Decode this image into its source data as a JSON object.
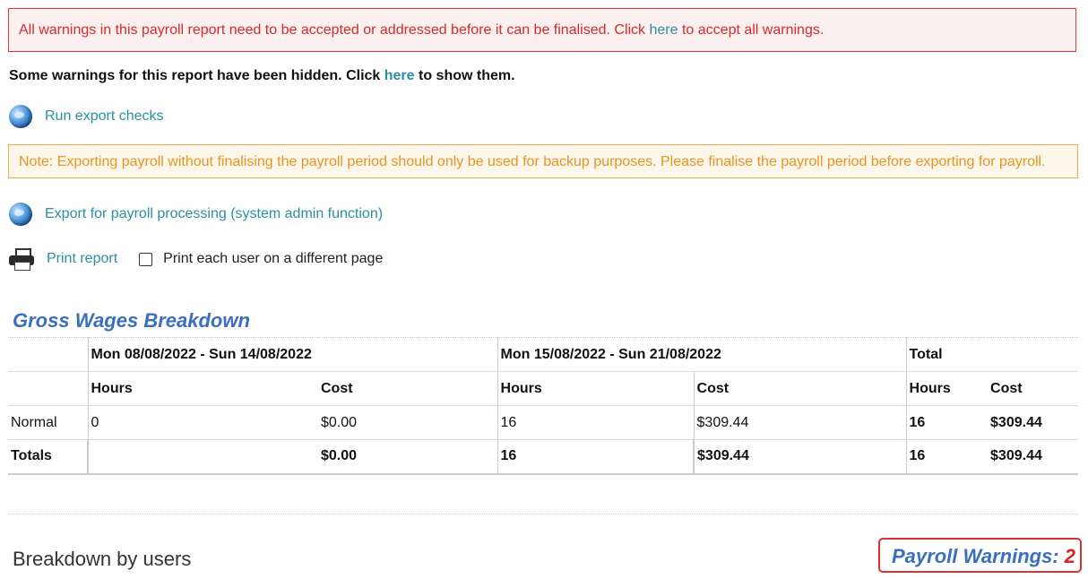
{
  "alert_red": {
    "text_before": "All warnings in this payroll report need to be accepted or addressed before it can be finalised. Click ",
    "link": "here",
    "text_after": " to accept all warnings."
  },
  "hidden_note": {
    "text_before": "Some warnings for this report have been hidden. Click ",
    "link": "here",
    "text_after": " to show them."
  },
  "actions": {
    "run_checks": "Run export checks",
    "export": "Export for payroll processing (system admin function)",
    "print": "Print report",
    "print_each_label": "Print each user on a different page"
  },
  "alert_orange": "Note: Exporting payroll without finalising the payroll period should only be used for backup purposes. Please finalise the payroll period before exporting for payroll.",
  "gross_wages": {
    "title": "Gross Wages Breakdown",
    "periods": [
      "Mon 08/08/2022 - Sun 14/08/2022",
      "Mon 15/08/2022 - Sun 21/08/2022",
      "Total"
    ],
    "sub_headers": [
      "Hours",
      "Cost"
    ],
    "rows": [
      {
        "label": "Normal",
        "values": [
          "0",
          "$0.00",
          "16",
          "$309.44",
          "16",
          "$309.44"
        ]
      },
      {
        "label": "Totals",
        "values": [
          "",
          "$0.00",
          "16",
          "$309.44",
          "16",
          "$309.44"
        ]
      }
    ]
  },
  "breakdown_title": "Breakdown by users",
  "payroll_warnings": {
    "label": "Payroll Warnings: ",
    "count": "2"
  },
  "colors": {
    "link": "#2b8fa4",
    "error": "#d32a2a",
    "warning": "#e89422",
    "title": "#3a6fc0"
  }
}
